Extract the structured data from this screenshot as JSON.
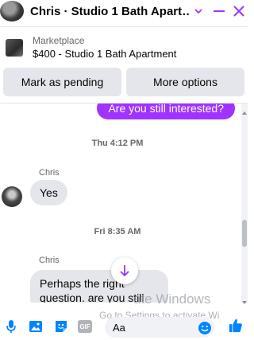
{
  "header": {
    "title": "Chris · Studio 1 Bath Apart…",
    "icons": {
      "avatar": "avatar",
      "chevron": "chevron-down-icon",
      "minimize": "minimize-icon",
      "close": "close-icon"
    }
  },
  "listing": {
    "label": "Marketplace",
    "item": "$400 - Studio 1 Bath Apartment"
  },
  "actions": {
    "mark_pending": "Mark as pending",
    "more_options": "More options"
  },
  "conversation": {
    "sent_message": "Are you still interested?",
    "stamp_1": "Thu 4:12 PM",
    "sender_1": "Chris",
    "message_1": "Yes",
    "stamp_2": "Fri 8:35 AM",
    "sender_2": "Chris",
    "message_2": "Perhaps the right question. are you still"
  },
  "overlay": {
    "watermark_line1": "ate Windows",
    "watermark_line2": "Go to Settings to activate Wi"
  },
  "composer": {
    "placeholder": "Aa"
  },
  "colors": {
    "accent": "#a033ff",
    "icon_blue": "#0084ff",
    "bubble_grey": "#e4e6eb"
  }
}
